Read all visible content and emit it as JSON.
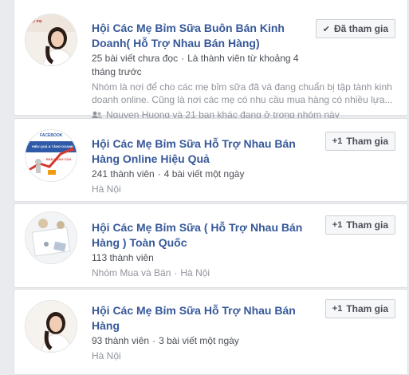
{
  "groups": [
    {
      "name": "Hội Các Mẹ Bỉm Sữa Buôn Bán Kinh Doanh( Hỗ Trợ Nhau Bán Hàng)",
      "meta_a": "25 bài viết chưa đọc",
      "meta_b": "Là thành viên từ khoảng 4 tháng trước",
      "description": "Nhóm là nơi để cho các mẹ bỉm sữa đã và đang chuẩn bị tập tành kinh doanh online. Cũng là nơi các mẹ có nhu cầu mua hàng có nhiều lựa...",
      "friends": "Nguyen Huong và 21 bạn khác đang ở trong nhóm này",
      "button": {
        "icon": "check-icon",
        "glyph": "✔",
        "label": "Đã tham gia"
      }
    },
    {
      "name": "Hội Các Mẹ Bỉm Sữa Hỗ Trợ Nhau Bán Hàng Online Hiệu Quả",
      "meta_a": "241 thành viên",
      "meta_b": "4 bài viết một ngày",
      "location": "Hà Nội",
      "button": {
        "icon": "plus-one-icon",
        "glyph": "+1",
        "label": "Tham gia"
      }
    },
    {
      "name": "Hội Các Mẹ Bỉm Sữa ( Hỗ Trợ Nhau Bán Hàng ) Toàn Quốc",
      "meta_a": "113 thành viên",
      "category": "Nhóm Mua và Bán",
      "location": "Hà Nội",
      "button": {
        "icon": "plus-one-icon",
        "glyph": "+1",
        "label": "Tham gia"
      }
    },
    {
      "name": "Hội Các Mẹ Bỉm Sữa Hỗ Trợ Nhau Bán Hàng",
      "meta_a": "93 thành viên",
      "meta_b": "3 bài viết một ngày",
      "location": "Hà Nội",
      "button": {
        "icon": "plus-one-icon",
        "glyph": "+1",
        "label": "Tham gia"
      }
    }
  ],
  "avatar_texts": {
    "g1_badge": "Hội mẹ",
    "g2_banner_1": "FACEBOOK",
    "g2_banner_2": "HIỆU QUẢ & TĂNG DOANH",
    "g2_banner_3": "BÁN HÀNG CỦA"
  },
  "colors": {
    "link": "#365899",
    "meta": "#4b4f56",
    "muted": "#90949c",
    "page_bg": "#e9ebee"
  }
}
